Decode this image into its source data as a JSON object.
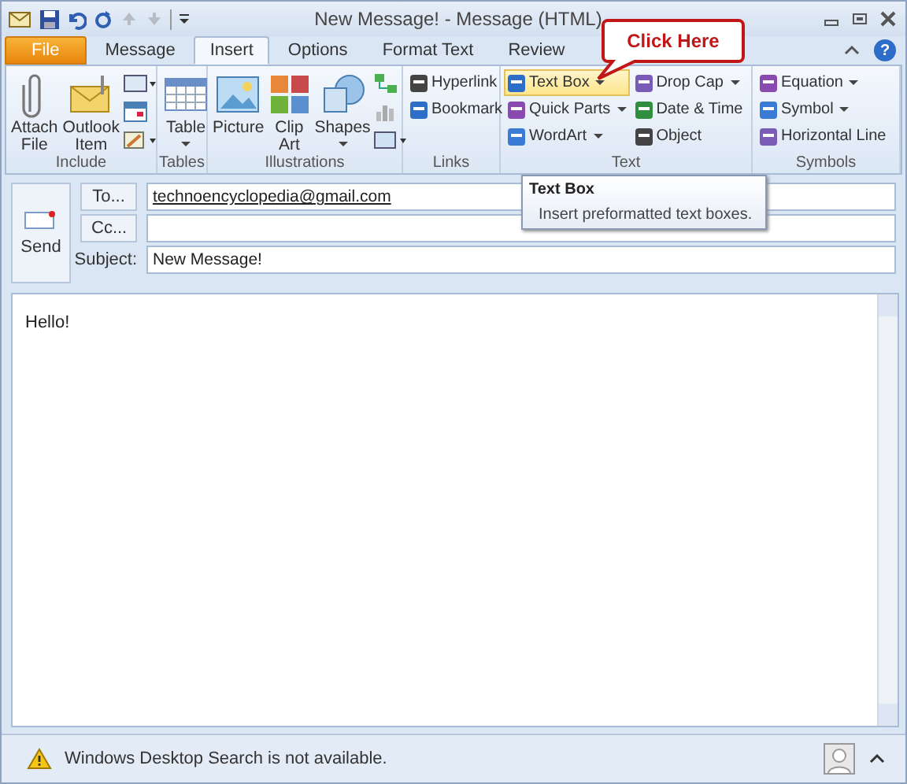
{
  "window": {
    "title": "New Message! - Message (HTML)"
  },
  "tabs": [
    {
      "label": "File",
      "kind": "file",
      "selected": false
    },
    {
      "label": "Message",
      "kind": "tab",
      "selected": false
    },
    {
      "label": "Insert",
      "kind": "tab",
      "selected": true
    },
    {
      "label": "Options",
      "kind": "tab",
      "selected": false
    },
    {
      "label": "Format Text",
      "kind": "tab",
      "selected": false
    },
    {
      "label": "Review",
      "kind": "tab",
      "selected": false
    }
  ],
  "help_button": "?",
  "ribbon": [
    {
      "label": "Include",
      "large": [
        {
          "label": "Attach File",
          "dropdown": false
        },
        {
          "label": "Outlook Item",
          "dropdown": false
        }
      ]
    },
    {
      "label": "Tables",
      "large": [
        {
          "label": "Table",
          "dropdown": true
        }
      ]
    },
    {
      "label": "Illustrations",
      "large": [
        {
          "label": "Picture",
          "dropdown": false
        },
        {
          "label": "Clip Art",
          "dropdown": false
        },
        {
          "label": "Shapes",
          "dropdown": true
        }
      ]
    },
    {
      "label": "Links",
      "small": [
        {
          "label": "Hyperlink",
          "dropdown": false,
          "hovered": false
        },
        {
          "label": "Bookmark",
          "dropdown": false,
          "hovered": false
        }
      ]
    },
    {
      "label": "Text",
      "small": [
        {
          "label": "Text Box",
          "dropdown": true,
          "hovered": true
        },
        {
          "label": "Quick Parts",
          "dropdown": true,
          "hovered": false
        },
        {
          "label": "WordArt",
          "dropdown": true,
          "hovered": false
        },
        {
          "label": "Drop Cap",
          "dropdown": true,
          "hovered": false
        },
        {
          "label": "Date & Time",
          "dropdown": false,
          "hovered": false
        },
        {
          "label": "Object",
          "dropdown": false,
          "hovered": false
        }
      ]
    },
    {
      "label": "Symbols",
      "small": [
        {
          "label": "Equation",
          "dropdown": true,
          "hovered": false
        },
        {
          "label": "Symbol",
          "dropdown": true,
          "hovered": false
        },
        {
          "label": "Horizontal Line",
          "dropdown": false,
          "hovered": false
        }
      ]
    }
  ],
  "callout": {
    "text": "Click Here"
  },
  "tooltip": {
    "title": "Text Box",
    "description": "Insert preformatted text boxes."
  },
  "header": {
    "send": "Send",
    "to_button": "To...",
    "to_value": "technoencyclopedia@gmail.com",
    "cc_button": "Cc...",
    "subject_label": "Subject:",
    "subject_value": "New Message!"
  },
  "body": {
    "text": "Hello!"
  },
  "status_bar": {
    "text": "Windows Desktop Search is not available."
  }
}
